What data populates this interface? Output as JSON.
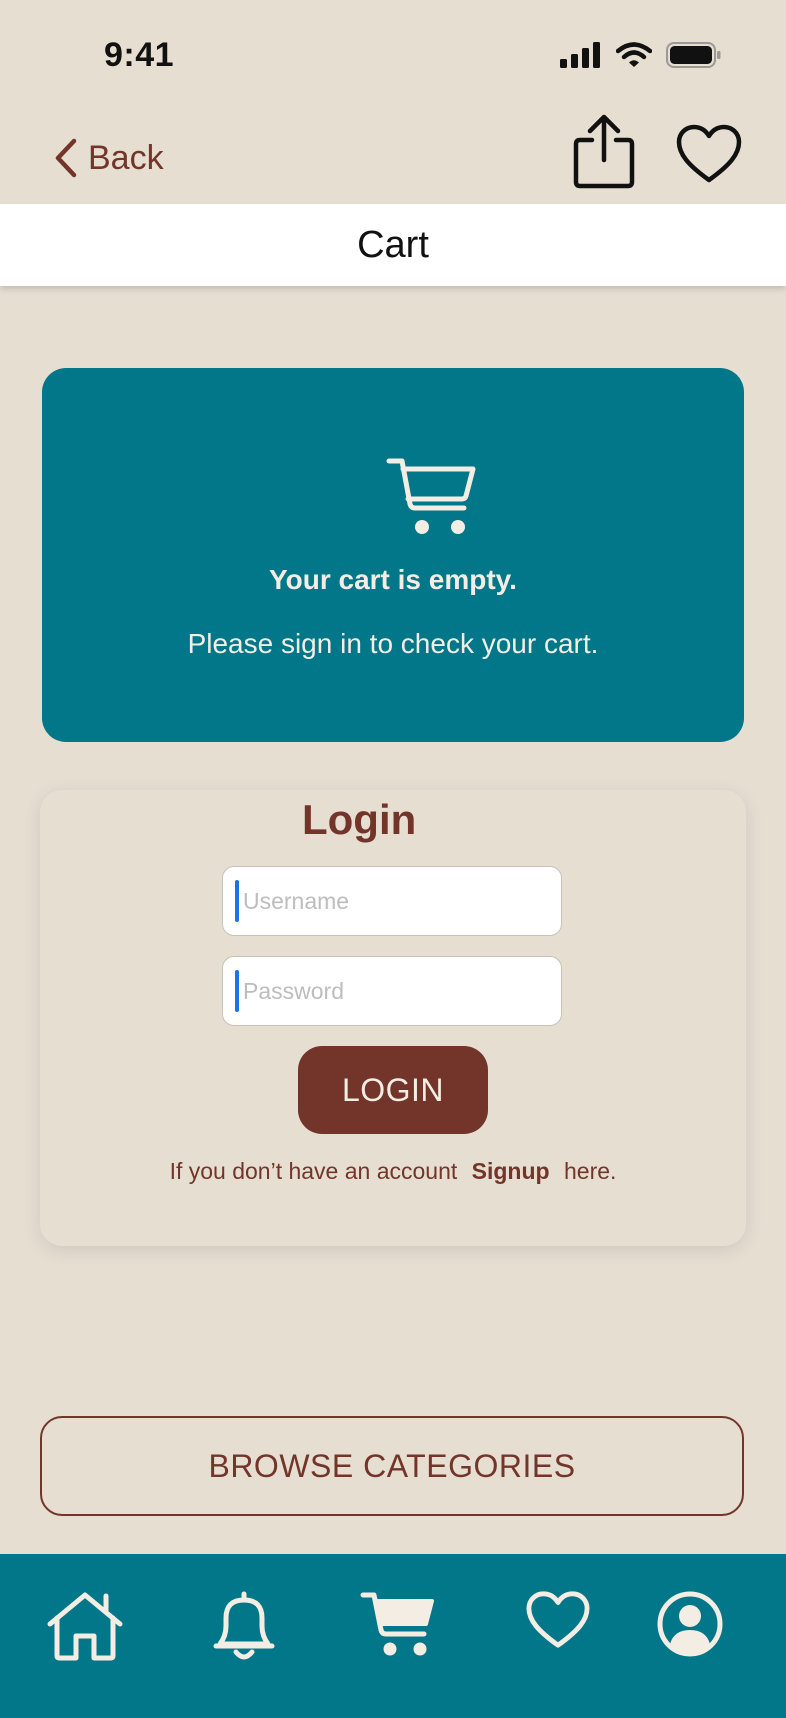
{
  "status_bar": {
    "time": "9:41"
  },
  "nav": {
    "back_label": "Back"
  },
  "page": {
    "title": "Cart"
  },
  "empty_cart": {
    "title": "Your cart is empty.",
    "message": "Please sign in to check your cart."
  },
  "login": {
    "title": "Login",
    "username_placeholder": "Username",
    "password_placeholder": "Password",
    "button_label": "LOGIN",
    "signup_prefix": "If you don’t have an account",
    "signup_link": "Signup",
    "signup_suffix": "here."
  },
  "browse": {
    "label": "BROWSE CATEGORIES"
  },
  "tab_bar": {
    "items": [
      {
        "icon": "home-icon"
      },
      {
        "icon": "bell-icon"
      },
      {
        "icon": "cart-icon"
      },
      {
        "icon": "heart-icon"
      },
      {
        "icon": "profile-icon"
      }
    ]
  },
  "colors": {
    "background": "#E6DED1",
    "teal": "#017789",
    "brown": "#73352A",
    "cream": "#F3EDE3"
  }
}
